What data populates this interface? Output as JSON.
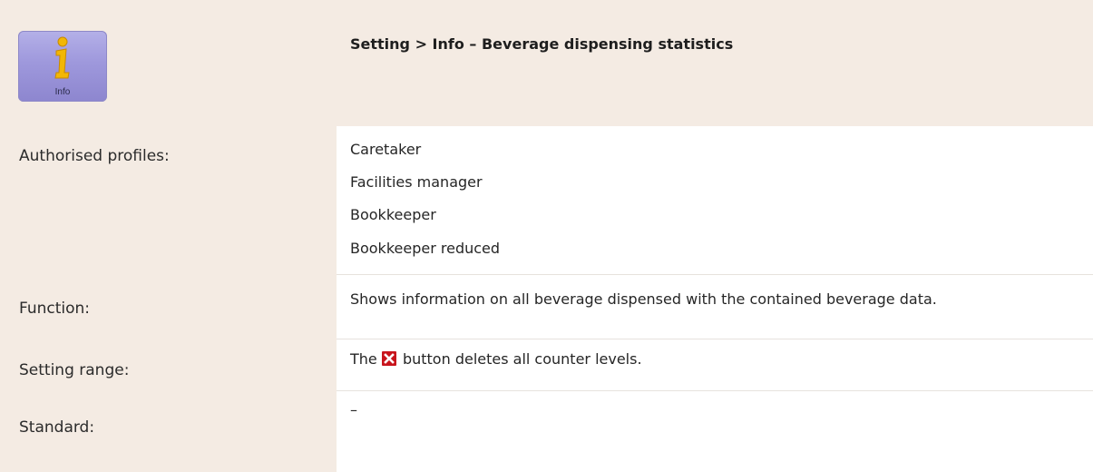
{
  "header": {
    "icon_caption": "Info",
    "title": "Setting > Info – Beverage dispensing statistics"
  },
  "rows": [
    {
      "label": "Authorised profiles:",
      "values": [
        "Caretaker",
        "Facilities manager",
        "Bookkeeper",
        "Bookkeeper reduced"
      ]
    },
    {
      "label": "Function:",
      "text": "Shows information on all beverage dispensed with the contained beverage data."
    },
    {
      "label": "Setting range:",
      "text_before": "The",
      "text_after": "button deletes all counter levels."
    },
    {
      "label": "Standard:",
      "text": "–"
    }
  ],
  "colors": {
    "band": "#f4ebe3",
    "icon_tile": "#9e98dc",
    "icon_glyph": "#f2b705",
    "delete_button": "#c8141c"
  },
  "icons": {
    "header_icon": "info-icon",
    "inline_icon": "delete-icon"
  }
}
